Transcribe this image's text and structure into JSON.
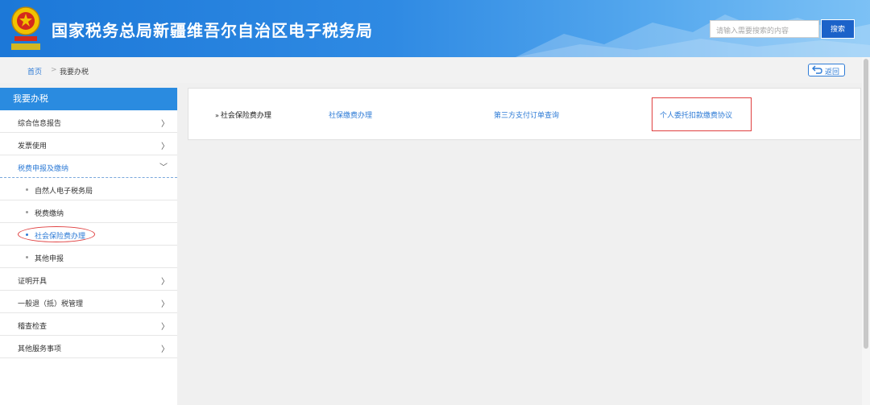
{
  "header": {
    "title": "国家税务总局新疆维吾尔自治区电子税务局",
    "search_placeholder": "请输入需要搜索的内容",
    "search_button": "搜索",
    "emblem_icon": "tax-emblem-icon"
  },
  "breadcrumb": {
    "home": "首页",
    "separator": ">",
    "current": "我要办税",
    "back_label": "返回"
  },
  "sidebar": {
    "title": "我要办税",
    "items": [
      {
        "label": "综合信息报告"
      },
      {
        "label": "发票使用"
      },
      {
        "label": "税费申报及缴纳"
      },
      {
        "label": "自然人电子税务局"
      },
      {
        "label": "税费缴纳"
      },
      {
        "label": "社会保险费办理"
      },
      {
        "label": "其他申报"
      },
      {
        "label": "证明开具"
      },
      {
        "label": "一般退（抵）税管理"
      },
      {
        "label": "稽查检查"
      },
      {
        "label": "其他服务事项"
      }
    ]
  },
  "main": {
    "category": "社会保险费办理",
    "links": [
      {
        "label": "社保缴费办理"
      },
      {
        "label": "第三方支付订单查询"
      },
      {
        "label": "个人委托扣款缴费协议"
      }
    ]
  },
  "colors": {
    "accent": "#2a8be0",
    "link": "#2e7bd6",
    "highlight": "#e04040",
    "search_button": "#1b62c9"
  }
}
